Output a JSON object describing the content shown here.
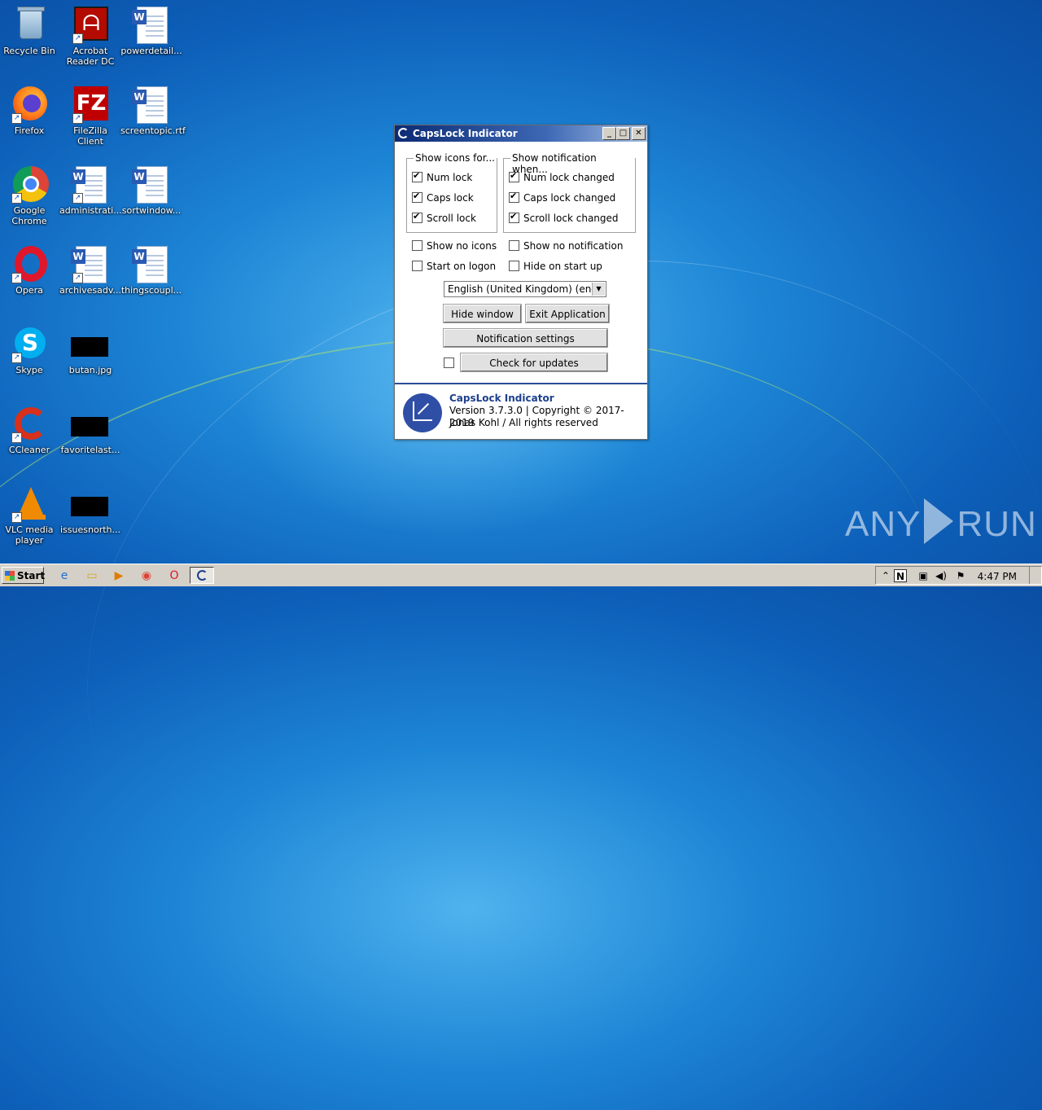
{
  "desktop": {
    "icons": [
      {
        "label": "Recycle Bin"
      },
      {
        "label": "Acrobat Reader DC"
      },
      {
        "label": "powerdetail..."
      },
      {
        "label": "Firefox"
      },
      {
        "label": "FileZilla Client"
      },
      {
        "label": "screentopic.rtf"
      },
      {
        "label": "Google Chrome"
      },
      {
        "label": "administrati..."
      },
      {
        "label": "sortwindow..."
      },
      {
        "label": "Opera"
      },
      {
        "label": "archivesadv..."
      },
      {
        "label": "thingscoupl..."
      },
      {
        "label": "Skype"
      },
      {
        "label": "butan.jpg"
      },
      {
        "label": "CCleaner"
      },
      {
        "label": "favoritelast..."
      },
      {
        "label": "VLC media player"
      },
      {
        "label": "issuesnorth..."
      }
    ]
  },
  "dialog": {
    "title": "CapsLock Indicator",
    "controls": {
      "minimize": "_",
      "maximize": "□",
      "close": "✕"
    },
    "show_icons": {
      "legend": "Show icons for...",
      "num": {
        "label": "Num lock",
        "checked": true
      },
      "caps": {
        "label": "Caps lock",
        "checked": true
      },
      "scroll": {
        "label": "Scroll lock",
        "checked": true
      }
    },
    "show_notification": {
      "legend": "Show notification when...",
      "num": {
        "label": "Num lock changed",
        "checked": true
      },
      "caps": {
        "label": "Caps lock changed",
        "checked": true
      },
      "scroll": {
        "label": "Scroll lock changed",
        "checked": true
      }
    },
    "options": {
      "no_icons": {
        "label": "Show no icons",
        "checked": false
      },
      "no_notification": {
        "label": "Show no notification",
        "checked": false
      },
      "start_logon": {
        "label": "Start on logon",
        "checked": false
      },
      "hide_startup": {
        "label": "Hide on start up",
        "checked": false
      }
    },
    "language_select": "English (United Kingdom) (en-G",
    "buttons": {
      "hide_window": "Hide window",
      "exit_app": "Exit Application",
      "notification_settings": "Notification settings",
      "check_updates": "Check for updates"
    },
    "update_checkbox_checked": false,
    "about": {
      "name": "CapsLock Indicator",
      "version": "Version 3.7.3.0 | Copyright © 2017-2019",
      "author": "Jonas Kohl / All rights reserved"
    }
  },
  "taskbar": {
    "start_label": "Start",
    "tray_n": "N",
    "clock": "4:47 PM"
  },
  "watermark": {
    "left": "ANY",
    "right": "RUN"
  }
}
